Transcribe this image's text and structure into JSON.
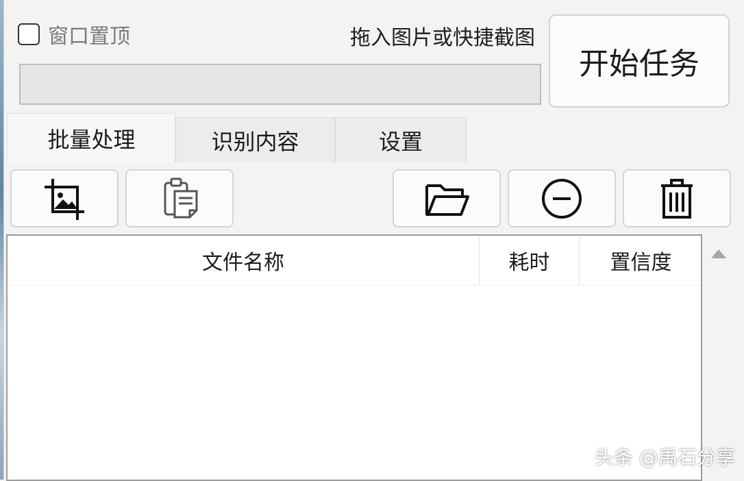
{
  "window": {
    "pin_label": "窗口置顶",
    "pin_checked": false,
    "drop_hint": "拖入图片或快捷截图",
    "start_button": "开始任务",
    "progress": 0
  },
  "tabs": [
    {
      "label": "批量处理",
      "active": true
    },
    {
      "label": "识别内容",
      "active": false
    },
    {
      "label": "设置",
      "active": false
    }
  ],
  "toolbar": {
    "icons": [
      "add-image-icon",
      "paste-clipboard-icon",
      "open-folder-icon",
      "remove-icon",
      "delete-trash-icon"
    ]
  },
  "table": {
    "columns": [
      "文件名称",
      "耗时",
      "置信度"
    ],
    "rows": []
  },
  "watermark": "头条 @禹石分享"
}
